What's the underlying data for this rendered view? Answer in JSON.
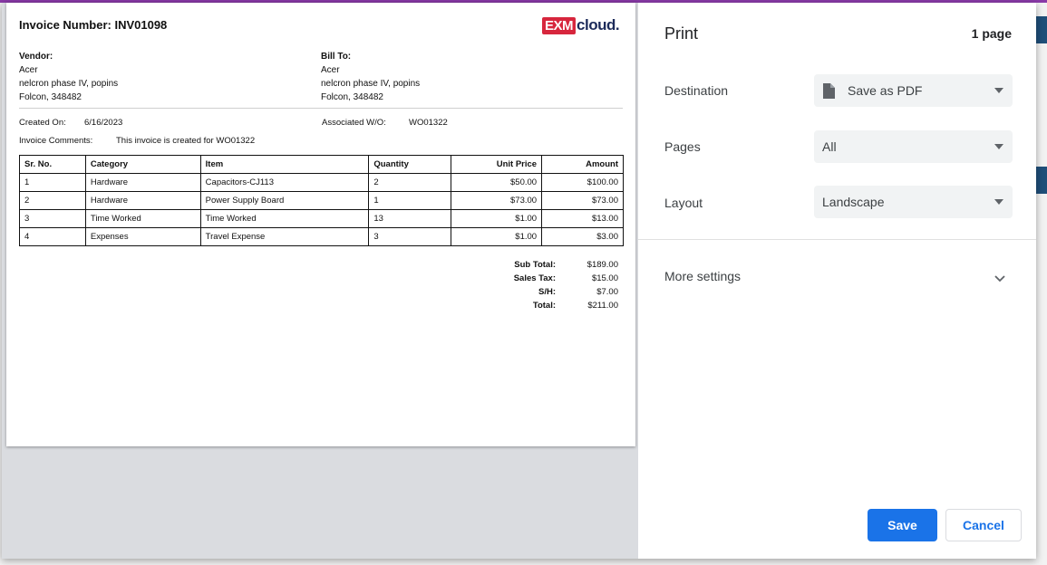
{
  "invoice": {
    "title": "Invoice Number: INV01098",
    "logo": {
      "box_text": "EXM",
      "text": "cloud."
    },
    "vendor": {
      "label": "Vendor:",
      "name": "Acer",
      "line1": "nelcron phase IV, popins",
      "line2": "Folcon, 348482"
    },
    "bill_to": {
      "label": "Bill To:",
      "name": "Acer",
      "line1": "nelcron phase IV, popins",
      "line2": "Folcon, 348482"
    },
    "created_on": {
      "label": "Created On:",
      "value": "6/16/2023"
    },
    "associated_wo": {
      "label": "Associated W/O:",
      "value": "WO01322"
    },
    "comments": {
      "label": "Invoice Comments:",
      "value": "This invoice is created for WO01322"
    },
    "columns": [
      "Sr. No.",
      "Category",
      "Item",
      "Quantity",
      "Unit Price",
      "Amount"
    ],
    "rows": [
      [
        "1",
        "Hardware",
        "Capacitors-CJ113",
        "2",
        "$50.00",
        "$100.00"
      ],
      [
        "2",
        "Hardware",
        "Power Supply Board",
        "1",
        "$73.00",
        "$73.00"
      ],
      [
        "3",
        "Time Worked",
        "Time Worked",
        "13",
        "$1.00",
        "$13.00"
      ],
      [
        "4",
        "Expenses",
        "Travel Expense",
        "3",
        "$1.00",
        "$3.00"
      ]
    ],
    "totals": [
      {
        "label": "Sub Total:",
        "value": "$189.00"
      },
      {
        "label": "Sales Tax:",
        "value": "$15.00"
      },
      {
        "label": "S/H:",
        "value": "$7.00"
      },
      {
        "label": "Total:",
        "value": "$211.00"
      }
    ]
  },
  "print": {
    "title": "Print",
    "page_count": "1 page",
    "destination": {
      "label": "Destination",
      "value": "Save as PDF",
      "icon": "document-icon"
    },
    "pages": {
      "label": "Pages",
      "value": "All"
    },
    "layout": {
      "label": "Layout",
      "value": "Landscape"
    },
    "more_settings": "More settings",
    "save_label": "Save",
    "cancel_label": "Cancel"
  },
  "colors": {
    "accent": "#1a73e8",
    "brand_red": "#d7263d",
    "brand_navy": "#1c2b5a",
    "topbar": "#8a3aa8"
  }
}
